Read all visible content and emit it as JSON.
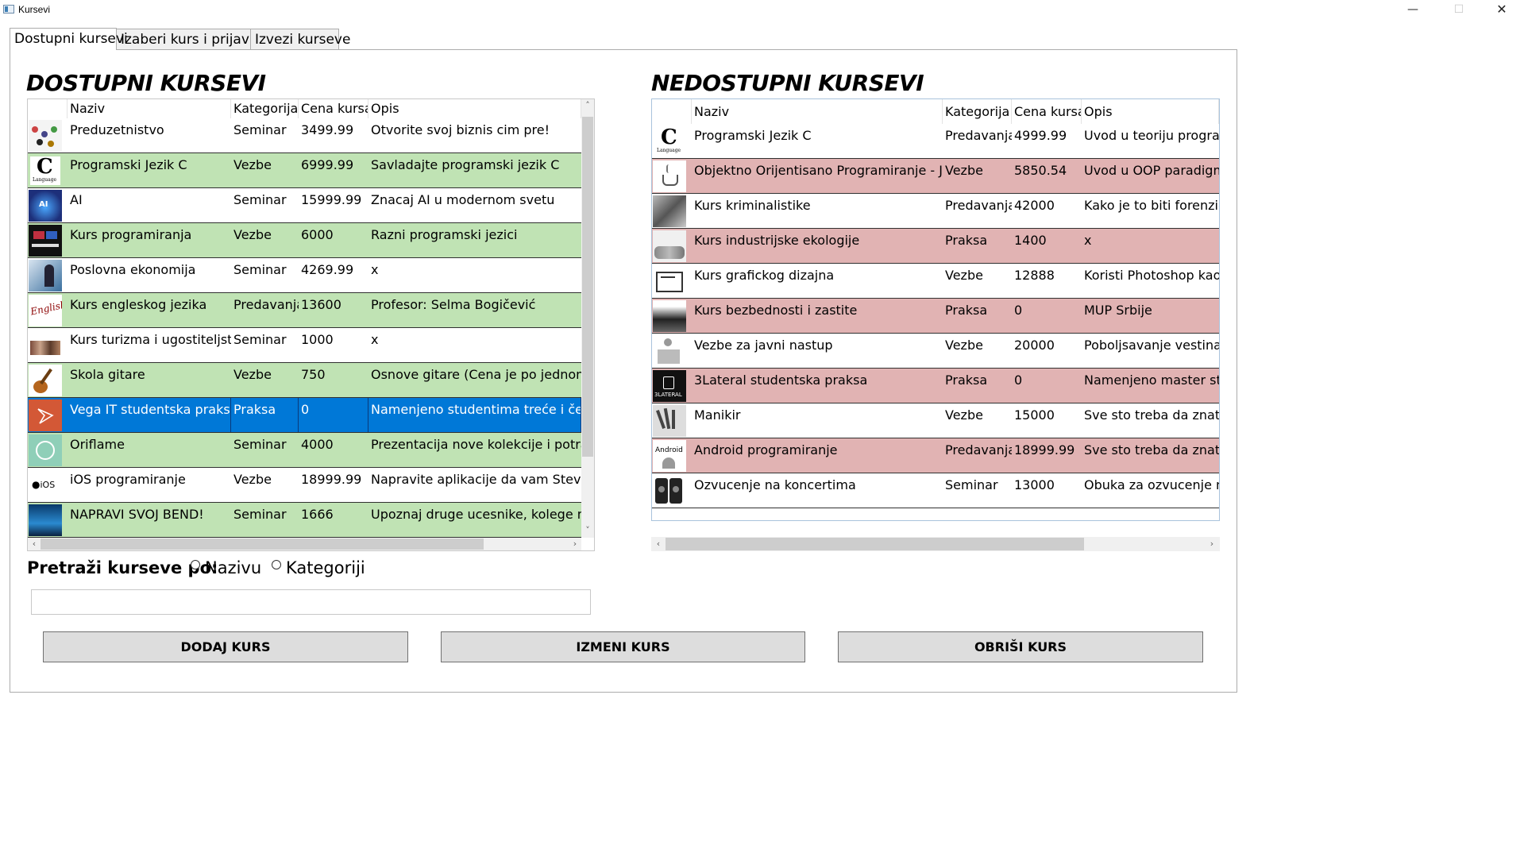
{
  "window": {
    "title": "Kursevi",
    "min_glyph": "—",
    "max_glyph": "☐",
    "close_glyph": "✕"
  },
  "tabs": [
    {
      "label": "Dostupni kursevi",
      "active": true
    },
    {
      "label": "Izaberi kurs i prijavi se",
      "active": false
    },
    {
      "label": "Izvezi kurseve",
      "active": false
    }
  ],
  "available": {
    "title": "DOSTUPNI KURSEVI",
    "columns": [
      "Naziv",
      "Kategorija",
      "Cena kursa",
      "Opis"
    ],
    "rows": [
      {
        "name": "Preduzetnistvo",
        "category": "Seminar",
        "price": "3499.99",
        "desc": "Otvorite svoj biznis cim pre!",
        "style": "white",
        "icon": "people-group-icon"
      },
      {
        "name": "Programski Jezik C",
        "category": "Vezbe",
        "price": "6999.99",
        "desc": "Savladajte programski jezik C",
        "style": "green",
        "icon": "c-language-icon"
      },
      {
        "name": "AI",
        "category": "Seminar",
        "price": "15999.99",
        "desc": "Znacaj AI u modernom svetu",
        "style": "white",
        "icon": "ai-brain-icon"
      },
      {
        "name": "Kurs programiranja",
        "category": "Vezbe",
        "price": "6000",
        "desc": "Razni programski jezici",
        "style": "green",
        "icon": "programmer-desk-icon"
      },
      {
        "name": "Poslovna ekonomija",
        "category": "Seminar",
        "price": "4269.99",
        "desc": "x",
        "style": "white",
        "icon": "business-icon"
      },
      {
        "name": "Kurs engleskog jezika",
        "category": "Predavanja",
        "price": "13600",
        "desc": "Profesor: Selma Bogičević",
        "style": "green",
        "icon": "english-text-icon"
      },
      {
        "name": "Kurs turizma i ugostiteljstvo",
        "category": "Seminar",
        "price": "1000",
        "desc": "x",
        "style": "white",
        "icon": "tourism-people-icon"
      },
      {
        "name": "Skola gitare",
        "category": "Vezbe",
        "price": "750",
        "desc": "Osnove gitare (Cena je po jednom ca",
        "style": "green",
        "icon": "guitar-icon"
      },
      {
        "name": "Vega IT studentska praksa",
        "category": "Praksa",
        "price": "0",
        "desc": "Namenjeno studentima treće i četvrt",
        "style": "sel",
        "icon": "vega-it-logo-icon"
      },
      {
        "name": "Oriflame",
        "category": "Seminar",
        "price": "4000",
        "desc": "Prezentacija nove kolekcije i potraga",
        "style": "green",
        "icon": "oriflame-logo-icon"
      },
      {
        "name": "iOS programiranje",
        "category": "Vezbe",
        "price": "18999.99",
        "desc": "Napravite aplikacije da vam Steve Jol",
        "style": "white",
        "icon": "apple-ios-icon"
      },
      {
        "name": "NAPRAVI SVOJ BEND!",
        "category": "Seminar",
        "price": "1666",
        "desc": "Upoznaj druge ucesnike, kolege muz",
        "style": "green",
        "icon": "concert-stage-icon"
      }
    ]
  },
  "unavailable": {
    "title": "NEDOSTUPNI KURSEVI",
    "columns": [
      "Naziv",
      "Kategorija",
      "Cena kursa",
      "Opis"
    ],
    "rows": [
      {
        "name": "Programski Jezik C",
        "category": "Predavanja",
        "price": "4999.99",
        "desc": "Uvod u teoriju program",
        "style": "white",
        "icon": "c-language-icon"
      },
      {
        "name": "Objektno Orijentisano Programiranje - Java",
        "category": "Vezbe",
        "price": "5850.54",
        "desc": "Uvod u OOP paradigmu",
        "style": "pink",
        "icon": "java-cup-icon"
      },
      {
        "name": "Kurs kriminalistike",
        "category": "Predavanja",
        "price": "42000",
        "desc": "Kako je to biti forenziča",
        "style": "white",
        "icon": "forensics-icon"
      },
      {
        "name": "Kurs industrijske ekologije",
        "category": "Praksa",
        "price": "1400",
        "desc": "x",
        "style": "pink",
        "icon": "ecology-icon"
      },
      {
        "name": "Kurs grafickog dizajna",
        "category": "Vezbe",
        "price": "12888",
        "desc": "Koristi Photoshop kao p",
        "style": "white",
        "icon": "design-sketch-icon"
      },
      {
        "name": "Kurs bezbednosti i zastite",
        "category": "Praksa",
        "price": "0",
        "desc": "MUP Srbije",
        "style": "pink",
        "icon": "security-icon"
      },
      {
        "name": "Vezbe za javni nastup",
        "category": "Vezbe",
        "price": "20000",
        "desc": "Poboljsavanje vestina ja",
        "style": "white",
        "icon": "public-speaking-icon"
      },
      {
        "name": "3Lateral studentska praksa",
        "category": "Praksa",
        "price": "0",
        "desc": "Namenjeno master stud",
        "style": "pink",
        "icon": "3lateral-logo-icon"
      },
      {
        "name": "Manikir",
        "category": "Vezbe",
        "price": "15000",
        "desc": "Sve sto treba da znate c",
        "style": "white",
        "icon": "manicure-hand-icon"
      },
      {
        "name": "Android programiranje",
        "category": "Predavanja",
        "price": "18999.99",
        "desc": "Sve sto treba da znate c",
        "style": "pink",
        "icon": "android-icon"
      },
      {
        "name": "Ozvucenje na koncertima",
        "category": "Seminar",
        "price": "13000",
        "desc": "Obuka za ozvucenje na",
        "style": "white",
        "icon": "speakers-icon"
      }
    ]
  },
  "search": {
    "label": "Pretraži kurseve po:",
    "option_name": "Nazivu",
    "option_category": "Kategoriji",
    "value": ""
  },
  "buttons": {
    "add": "DODAJ KURS",
    "edit": "IZMENI KURS",
    "delete": "OBRIŠI KURS"
  },
  "thumb_text": {
    "c_letter": "C",
    "c_caption": "Language",
    "ai": "AI",
    "english": "English",
    "ios": "iOS",
    "android": "Android",
    "lateral": "3LATERAL"
  },
  "colors": {
    "row_green": "#c0e3b4",
    "row_pink": "#e1b3b3",
    "row_selected": "#0078d7"
  }
}
